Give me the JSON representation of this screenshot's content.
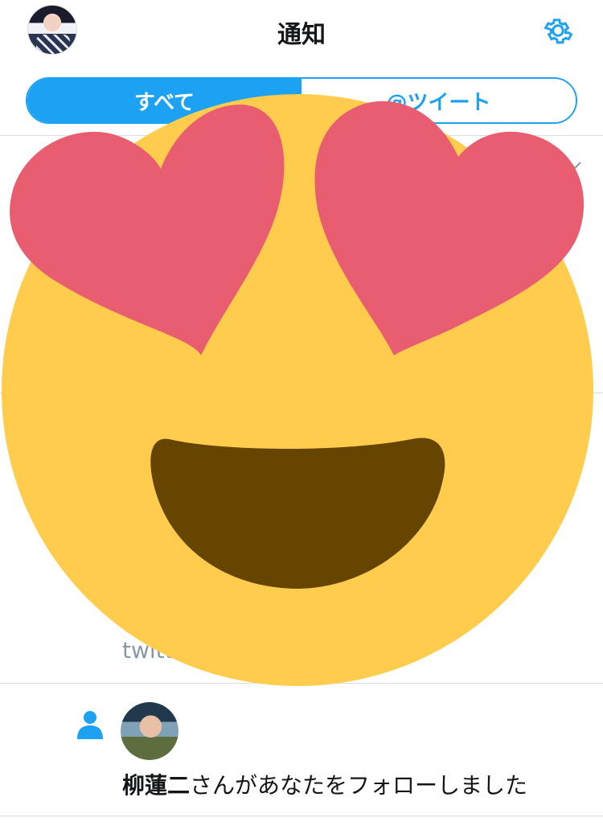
{
  "header": {
    "title": "通知",
    "avatar_icon": "user-avatar",
    "settings_icon": "gear-icon"
  },
  "tabs": [
    {
      "label": "すべて",
      "active": true
    },
    {
      "label": "@ツイート",
      "active": false
    }
  ],
  "feed_remnant": {
    "text": "twitt... ..."
  },
  "follow_notification": {
    "icon": "person-icon",
    "user_name": "柳蓮二",
    "message": "さんがあなたをフォローしました"
  },
  "overlay": {
    "icon": "heart-eyes-emoji-icon"
  },
  "colors": {
    "accent": "#1da1f2",
    "emoji_face": "#ffcc4d",
    "emoji_heart": "#e85d6f",
    "emoji_mouth": "#664500"
  }
}
